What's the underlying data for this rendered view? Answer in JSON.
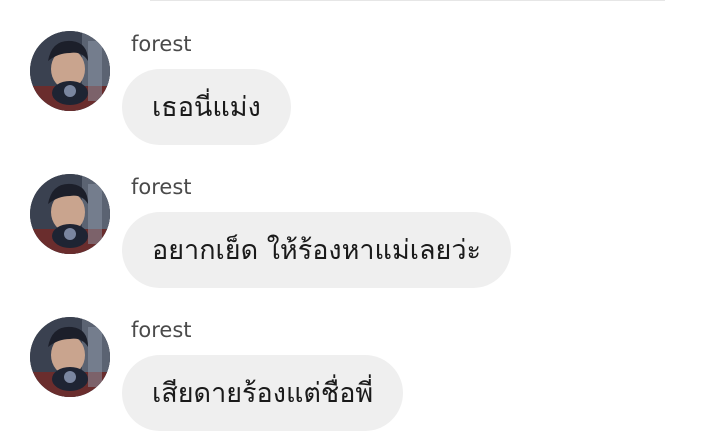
{
  "thread": {
    "messages": [
      {
        "sender": "forest",
        "text": "เธอนี่แม่ง"
      },
      {
        "sender": "forest",
        "text": "อยากเย็ด ให้ร้องหาแม่เลยว่ะ"
      },
      {
        "sender": "forest",
        "text": "เสียดายร้องแต่ชื่อพี่"
      }
    ]
  },
  "colors": {
    "bubble": "#efefef",
    "sender_text": "#4a4a4a",
    "message_text": "#1a1a1a"
  }
}
